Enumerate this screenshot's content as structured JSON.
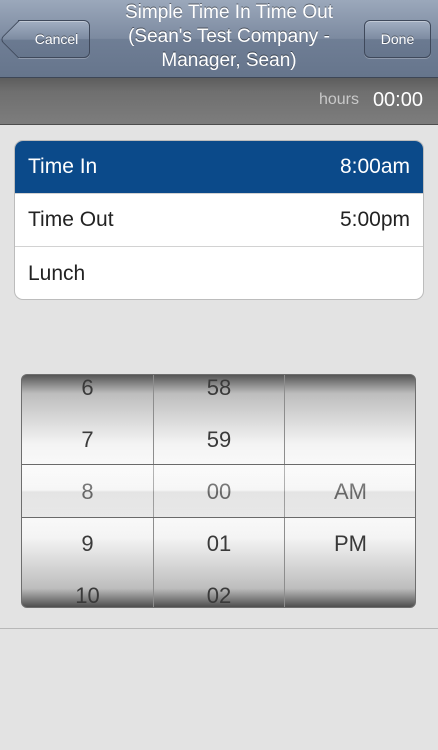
{
  "nav": {
    "title": "Simple Time In Time Out\n(Sean's Test Company -\nManager, Sean)",
    "cancel_label": "Cancel",
    "done_label": "Done"
  },
  "hours": {
    "label": "hours",
    "value": "00:00"
  },
  "rows": [
    {
      "label": "Time In",
      "value": "8:00am"
    },
    {
      "label": "Time Out",
      "value": "5:00pm"
    },
    {
      "label": "Lunch",
      "value": ""
    }
  ],
  "picker": {
    "hours": [
      "6",
      "7",
      "8",
      "9",
      "10"
    ],
    "minutes": [
      "58",
      "59",
      "00",
      "01",
      "02"
    ],
    "ampm": [
      "",
      "",
      "AM",
      "PM",
      ""
    ]
  }
}
